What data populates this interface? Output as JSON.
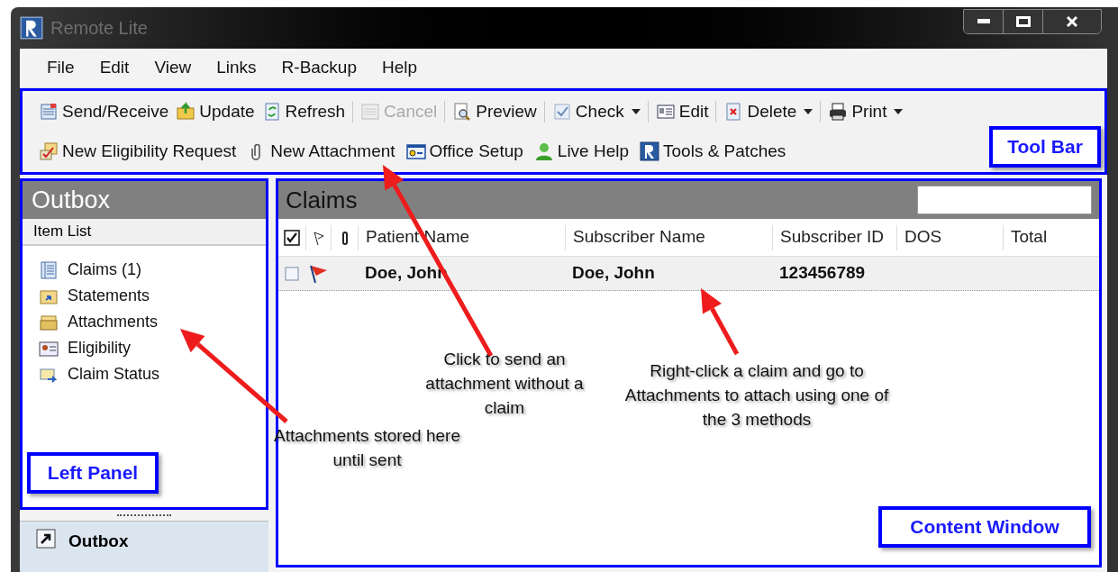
{
  "window": {
    "title": "Remote Lite"
  },
  "menu": [
    "File",
    "Edit",
    "View",
    "Links",
    "R-Backup",
    "Help"
  ],
  "toolbar": {
    "rows": [
      {
        "items": [
          {
            "kind": "button",
            "label": "Send/Receive",
            "disabled": false,
            "dropdown": false
          },
          {
            "kind": "button",
            "label": "Update",
            "disabled": false,
            "dropdown": false
          },
          {
            "kind": "button",
            "label": "Refresh",
            "disabled": false,
            "dropdown": false
          },
          {
            "kind": "separator"
          },
          {
            "kind": "button",
            "label": "Cancel",
            "disabled": true,
            "dropdown": false
          },
          {
            "kind": "separator"
          },
          {
            "kind": "button",
            "label": "Preview",
            "disabled": false,
            "dropdown": false
          },
          {
            "kind": "separator"
          },
          {
            "kind": "button",
            "label": "Check",
            "disabled": false,
            "dropdown": true
          },
          {
            "kind": "separator"
          },
          {
            "kind": "button",
            "label": "Edit",
            "disabled": false,
            "dropdown": false
          },
          {
            "kind": "separator"
          },
          {
            "kind": "button",
            "label": "Delete",
            "disabled": false,
            "dropdown": true
          },
          {
            "kind": "separator"
          },
          {
            "kind": "button",
            "label": "Print",
            "disabled": false,
            "dropdown": true
          }
        ]
      },
      {
        "items": [
          {
            "kind": "button",
            "label": "New Eligibility Request",
            "disabled": false,
            "dropdown": false
          },
          {
            "kind": "button",
            "label": "New Attachment",
            "disabled": false,
            "dropdown": false
          },
          {
            "kind": "button",
            "label": "Office Setup",
            "disabled": false,
            "dropdown": false
          },
          {
            "kind": "button",
            "label": "Live Help",
            "disabled": false,
            "dropdown": false
          },
          {
            "kind": "button",
            "label": "Tools & Patches",
            "disabled": false,
            "dropdown": false
          }
        ]
      }
    ]
  },
  "left_panel": {
    "title": "Outbox",
    "subtitle": "Item List",
    "items": [
      "Claims (1)",
      "Statements",
      "Attachments",
      "Eligibility",
      "Claim Status"
    ],
    "bottom_button": "Outbox"
  },
  "content": {
    "title": "Claims",
    "header_checked": true,
    "columns": [
      "Patient Name",
      "Subscriber Name",
      "Subscriber ID",
      "DOS",
      "Total"
    ],
    "rows": [
      {
        "checked": false,
        "flagged": true,
        "patient": "Doe, John",
        "subscriber": "Doe, John",
        "subscriber_id": "123456789"
      }
    ]
  },
  "annotations": [
    {
      "kind": "callout",
      "text": "Tool Bar"
    },
    {
      "kind": "note",
      "text": "Click to send an attachment without a claim"
    },
    {
      "kind": "note",
      "text": "Right-click a claim and go to Attachments to attach using one of the 3 methods"
    },
    {
      "kind": "note",
      "text": "Attachments stored here until sent"
    },
    {
      "kind": "callout",
      "text": "Left Panel"
    },
    {
      "kind": "callout",
      "text": "Content Window"
    }
  ]
}
